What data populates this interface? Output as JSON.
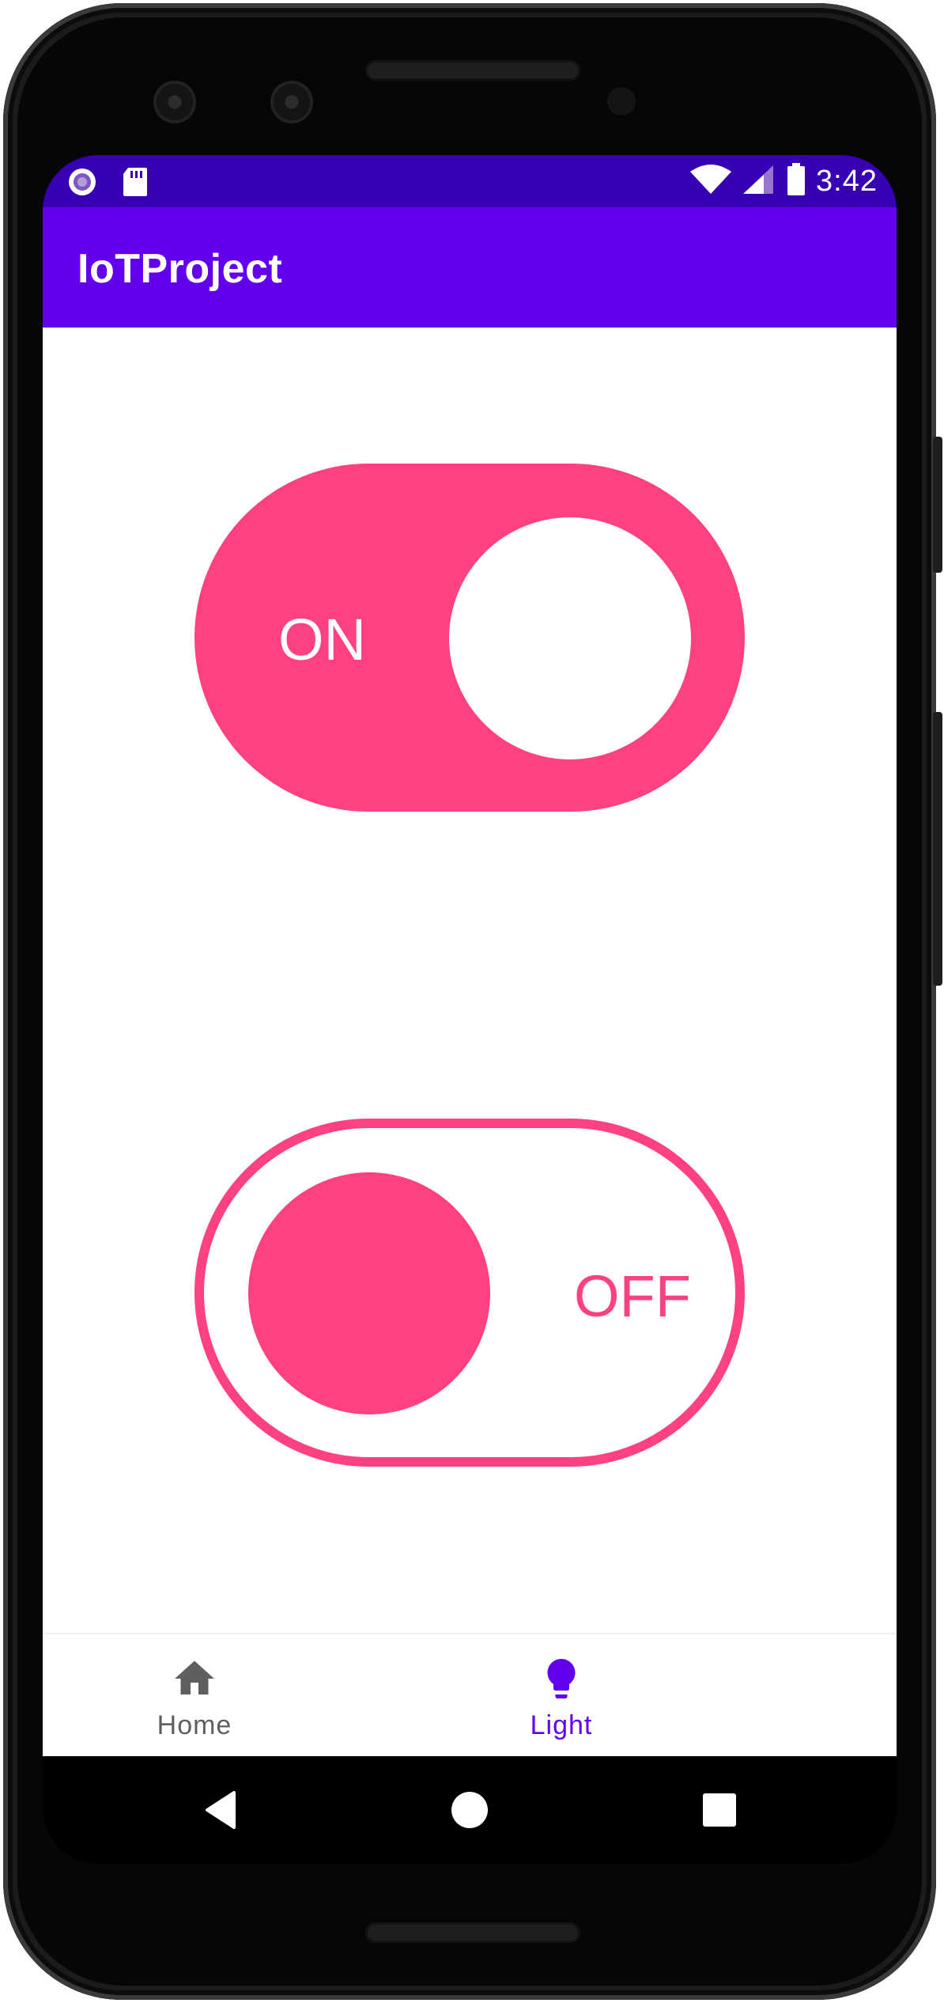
{
  "status_bar": {
    "time": "3:42",
    "left_icons": [
      "circle-notification-icon",
      "sd-card-icon"
    ],
    "right_icons": [
      "wifi-icon",
      "signal-icon",
      "battery-icon"
    ],
    "background_color": "#3700b3"
  },
  "app_bar": {
    "title": "IoTProject",
    "background_color": "#6200ee"
  },
  "toggles": [
    {
      "label": "ON",
      "state": "on",
      "accent_color": "#ff4081"
    },
    {
      "label": "OFF",
      "state": "off",
      "accent_color": "#ff4081"
    }
  ],
  "bottom_nav": {
    "items": [
      {
        "label": "Home",
        "icon": "home-icon",
        "selected": false
      },
      {
        "label": "Light",
        "icon": "lightbulb-icon",
        "selected": true
      }
    ],
    "selected_color": "#6200ee",
    "unselected_color": "#5f5f5f"
  },
  "system_nav": {
    "buttons": [
      "back-icon",
      "home-circle-icon",
      "recents-icon"
    ]
  }
}
